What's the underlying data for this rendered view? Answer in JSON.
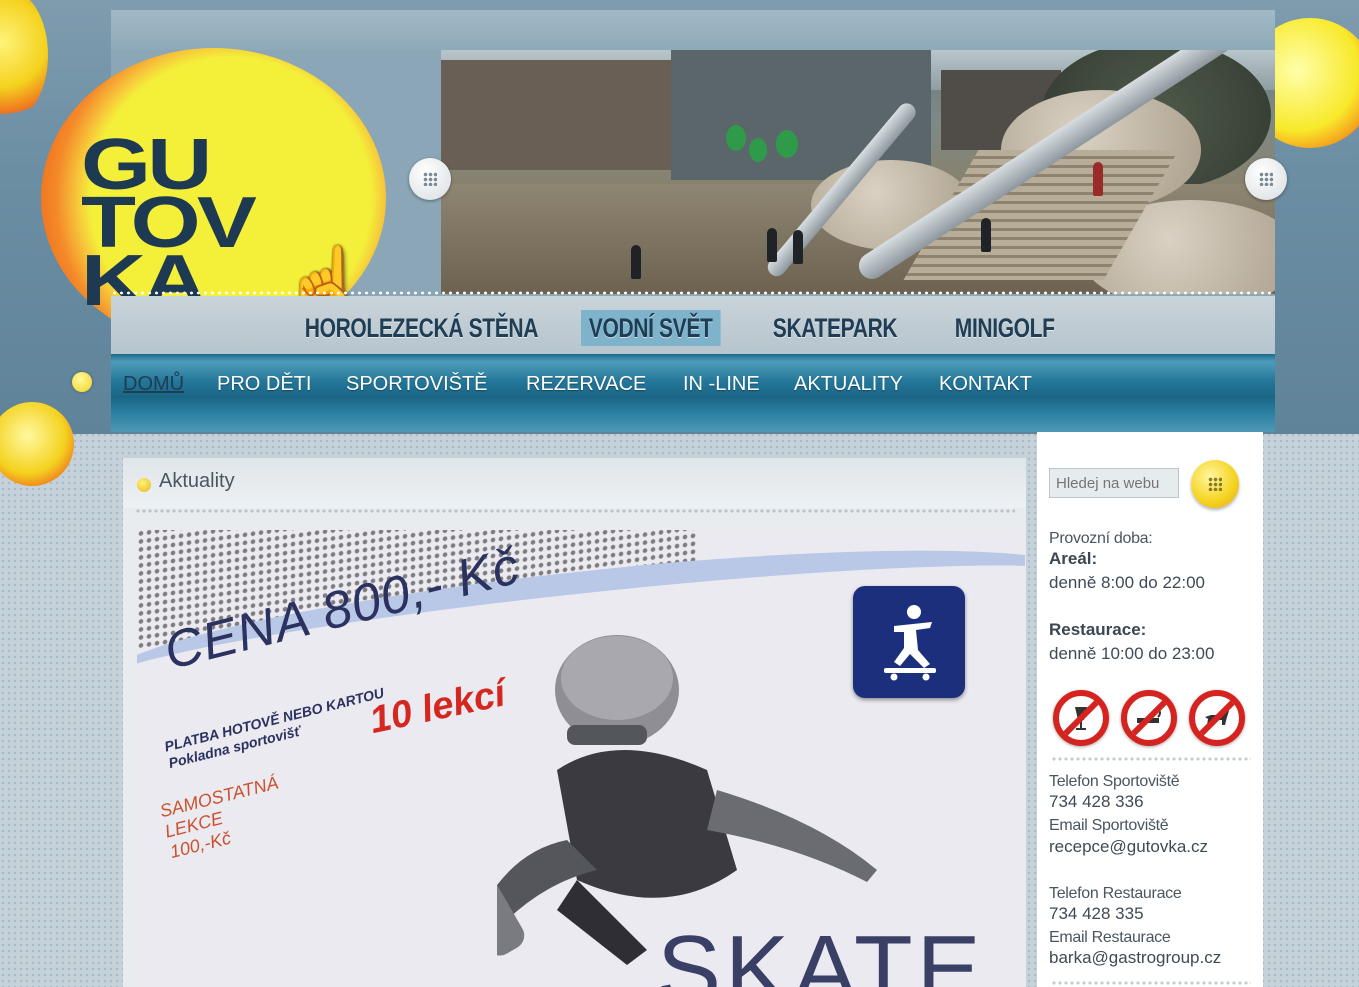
{
  "logo": {
    "lines": [
      "GU",
      "TOV",
      "KA"
    ]
  },
  "header_nav": {
    "items": [
      {
        "label": "HOROLEZECKÁ STĚNA"
      },
      {
        "label": "VODNÍ SVĚT",
        "active": true
      },
      {
        "label": "SKATEPARK"
      },
      {
        "label": "MINIGOLF"
      }
    ]
  },
  "main_nav": {
    "items": [
      {
        "label": "DOMŮ",
        "active": true
      },
      {
        "label": "PRO DĚTI"
      },
      {
        "label": "SPORTOVIŠTĚ"
      },
      {
        "label": "REZERVACE"
      },
      {
        "label": "IN -LINE"
      },
      {
        "label": "AKTUALITY"
      },
      {
        "label": "KONTAKT"
      }
    ]
  },
  "content": {
    "title": "Aktuality",
    "banner": {
      "price": "CENA 800,- Kč",
      "payment": "PLATBA HOTOVĚ NEBO KARTOU",
      "place": "Pokladna sportovišť",
      "lessons": "10 lekcí",
      "single_1": "SAMOSTATNÁ",
      "single_2": "LEKCE",
      "single_3": "100,-Kč",
      "skate": "SKATE"
    }
  },
  "sidebar": {
    "search_placeholder": "Hledej na webu",
    "hours_label": "Provozní doba:",
    "areal_label": "Areál:",
    "areal_hours": "denně 8:00 do 22:00",
    "restaurant_label": "Restaurace:",
    "restaurant_hours": "denně 10:00 do 23:00",
    "phone_sport_label": "Telefon Sportoviště",
    "phone_sport": "734 428 336",
    "email_sport_label": "Email Sportoviště",
    "email_sport": "recepce@gutovka.cz",
    "phone_rest_label": "Telefon Restaurace",
    "phone_rest": "734 428 335",
    "email_rest_label": "Email Restaurace",
    "email_rest": "barka@gastrogroup.cz"
  },
  "colors": {
    "accent_yellow": "#f4f03a",
    "accent_orange": "#f0731e",
    "nav_blue": "#1d6a8a",
    "brand_dark": "#1e3a52",
    "prohibition_red": "#d5231f"
  },
  "icons": [
    "slider-prev-icon",
    "slider-next-icon",
    "search-icon",
    "no-glass-icon",
    "no-smoking-icon",
    "no-dogs-icon",
    "skateboard-sign-icon",
    "pointer-hand-icon"
  ]
}
